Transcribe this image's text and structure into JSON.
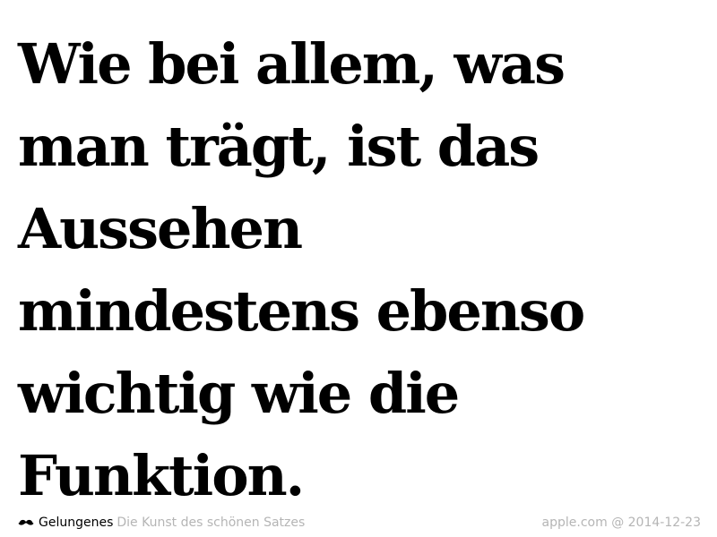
{
  "quote": {
    "lines": [
      "Wie bei allem, was",
      "man trägt, ist das",
      "Aussehen",
      "mindestens ebenso",
      "wichtig wie die",
      "Funktion."
    ]
  },
  "footer": {
    "logo_icon": "mustache-icon",
    "brand": "Gelungenes",
    "tagline": "Die Kunst des schönen Satzes",
    "source": "apple.com @ 2014-12-23"
  }
}
